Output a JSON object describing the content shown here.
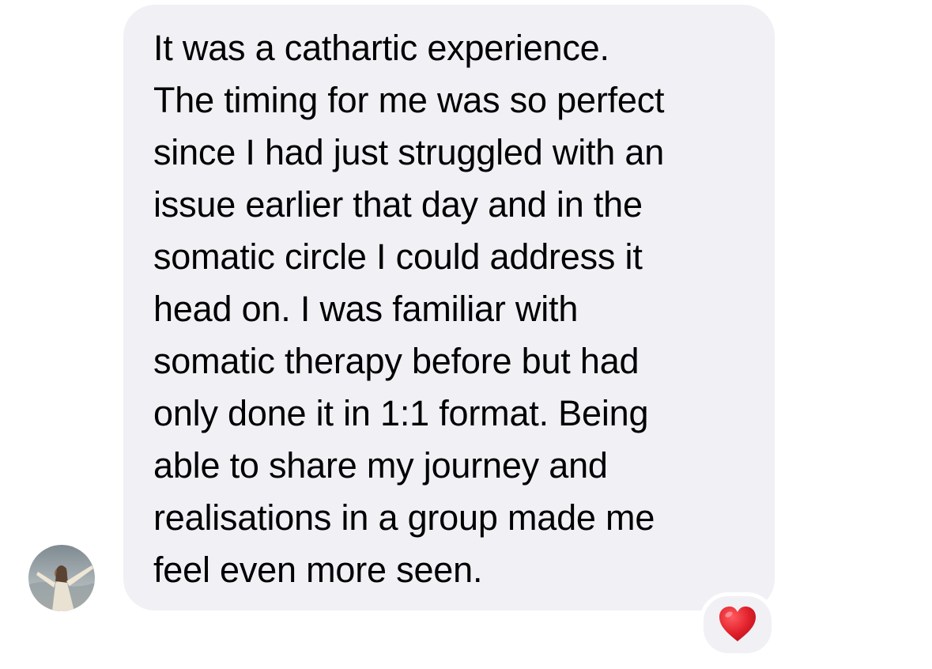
{
  "message": {
    "lines": [
      "It was a cathartic experience.",
      "The timing for me was so perfect",
      "since I had just struggled with an",
      "issue earlier that day and in the",
      "somatic circle I could address it",
      "head on. I was familiar with",
      "somatic therapy before but had",
      "only done it in 1:1 format. Being",
      "able to share my journey and",
      "realisations in a group made me",
      "feel even more seen."
    ],
    "bubble_color": "#f0f0f5",
    "text_color": "#000000"
  },
  "sender": {
    "avatar_icon": "profile-photo"
  },
  "reaction": {
    "icon": "red-heart-icon",
    "color": "#e0202a"
  }
}
